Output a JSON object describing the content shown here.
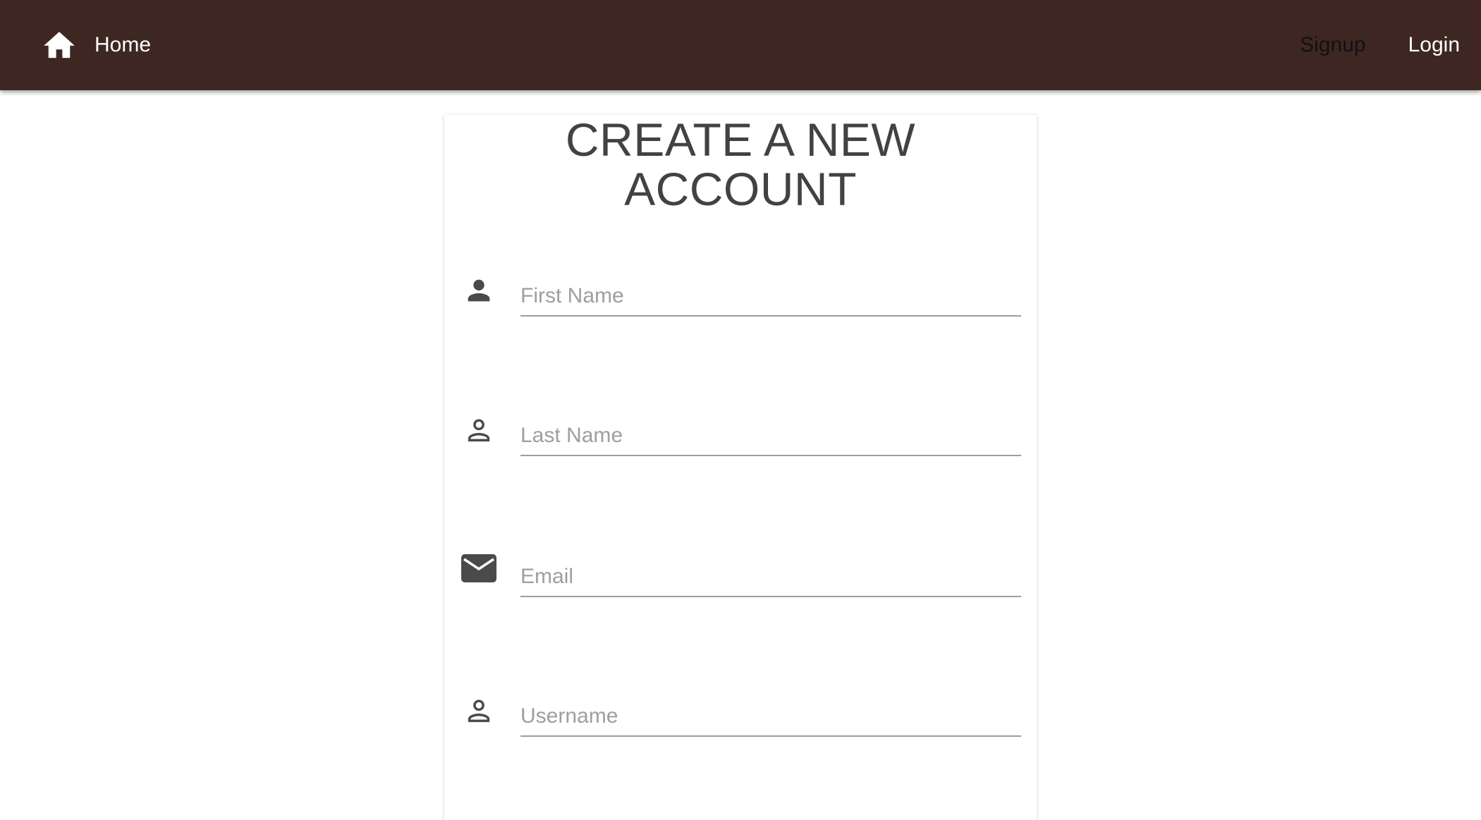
{
  "nav": {
    "home_label": "Home",
    "signup_label": "Signup",
    "login_label": "Login",
    "bar_color": "#3e2723"
  },
  "form": {
    "title": "CREATE A NEW ACCOUNT",
    "fields": [
      {
        "icon": "person-filled-icon",
        "placeholder": "First Name",
        "value": ""
      },
      {
        "icon": "person-outline-icon",
        "placeholder": "Last Name",
        "value": ""
      },
      {
        "icon": "email-icon",
        "placeholder": "Email",
        "value": ""
      },
      {
        "icon": "person-outline-icon",
        "placeholder": "Username",
        "value": ""
      }
    ]
  }
}
